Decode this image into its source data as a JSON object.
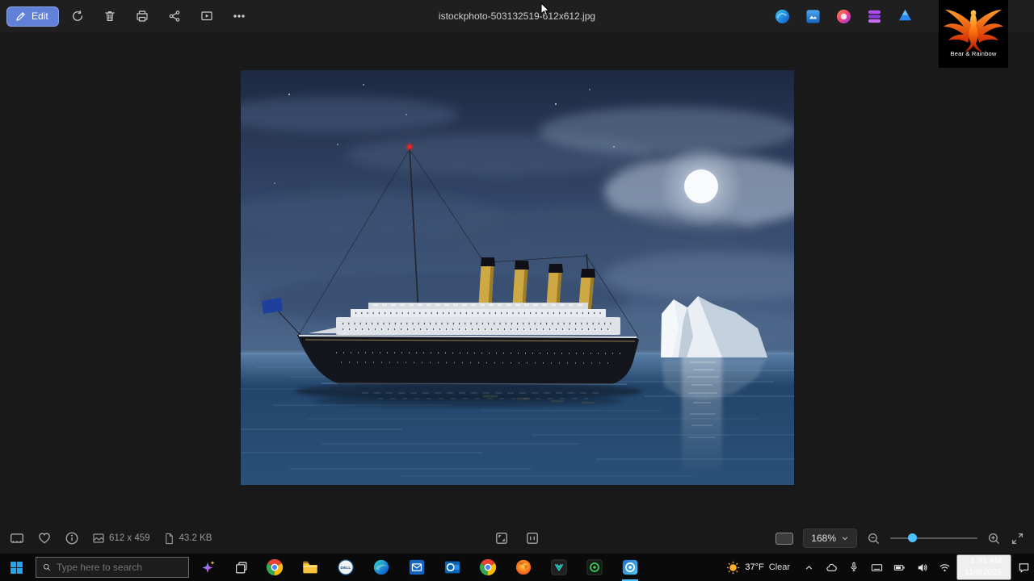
{
  "titlebar": {
    "edit_label": "Edit",
    "filename": "istockphoto-503132519-612x612.jpg"
  },
  "watermark": {
    "label": "Bear & Rainbow"
  },
  "statusbar": {
    "dimensions": "612 x 459",
    "filesize": "43.2 KB",
    "zoom_value": "168%"
  },
  "taskbar": {
    "search_placeholder": "Type here to search",
    "dell_label": "DELL",
    "weather_temp": "37°F",
    "weather_condition": "Clear",
    "clock_time": "1:31 AM",
    "clock_date": "11/8/2025"
  },
  "colors": {
    "accent": "#4cc2ff",
    "edit_button": "#6180d8",
    "topbar_bg": "#1f1f1f",
    "canvas_bg": "#191919",
    "taskbar_bg": "#0a0a0a"
  }
}
